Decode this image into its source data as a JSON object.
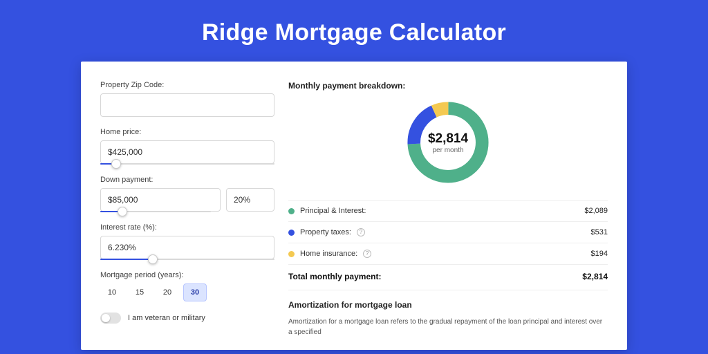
{
  "hero": {
    "title": "Ridge Mortgage Calculator"
  },
  "form": {
    "zip": {
      "label": "Property Zip Code:",
      "value": ""
    },
    "price": {
      "label": "Home price:",
      "value": "$425,000",
      "slider_pct": 9
    },
    "down": {
      "label": "Down payment:",
      "amount": "$85,000",
      "percent": "20%",
      "slider_pct": 20
    },
    "rate": {
      "label": "Interest rate (%):",
      "value": "6.230%",
      "slider_pct": 30
    },
    "period": {
      "label": "Mortgage period (years):",
      "options": [
        "10",
        "15",
        "20",
        "30"
      ],
      "selected": "30"
    },
    "veteran": {
      "label": "I am veteran or military",
      "on": false
    }
  },
  "breakdown": {
    "title": "Monthly payment breakdown:",
    "center_amount": "$2,814",
    "center_sub": "per month",
    "items": [
      {
        "label": "Principal & Interest:",
        "value": "$2,089",
        "color": "#4fb08a",
        "info": false
      },
      {
        "label": "Property taxes:",
        "value": "$531",
        "color": "#3451e0",
        "info": true
      },
      {
        "label": "Home insurance:",
        "value": "$194",
        "color": "#f4c951",
        "info": true
      }
    ],
    "total_label": "Total monthly payment:",
    "total_value": "$2,814"
  },
  "amort": {
    "title": "Amortization for mortgage loan",
    "text": "Amortization for a mortgage loan refers to the gradual repayment of the loan principal and interest over a specified"
  },
  "chart_data": {
    "type": "pie",
    "title": "Monthly payment breakdown",
    "categories": [
      "Principal & Interest",
      "Property taxes",
      "Home insurance"
    ],
    "values": [
      2089,
      531,
      194
    ],
    "colors": [
      "#4fb08a",
      "#3451e0",
      "#f4c951"
    ],
    "total": 2814,
    "center_label": "$2,814 per month"
  }
}
